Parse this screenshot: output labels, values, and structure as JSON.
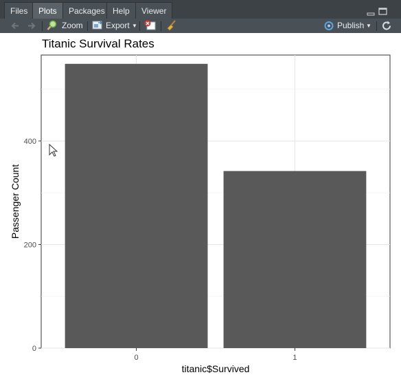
{
  "tabs": [
    {
      "label": "Files",
      "active": false
    },
    {
      "label": "Plots",
      "active": true
    },
    {
      "label": "Packages",
      "active": false
    },
    {
      "label": "Help",
      "active": false
    },
    {
      "label": "Viewer",
      "active": false
    }
  ],
  "toolbar": {
    "zoom_label": "Zoom",
    "export_label": "Export",
    "publish_label": "Publish"
  },
  "icons": {
    "back": "arrow-left-icon",
    "forward": "arrow-right-icon",
    "zoom": "magnifier-icon",
    "export": "export-icon",
    "remove": "remove-plot-icon",
    "clear": "broom-icon",
    "publish": "publish-icon",
    "refresh": "refresh-icon"
  },
  "colors": {
    "bar_fill": "#595959",
    "panel_background": "#ffffff",
    "grid": "#ebebeb",
    "tab_active": "#5b6368",
    "tabbar": "#3c4246"
  },
  "chart_data": {
    "type": "bar",
    "title": "Titanic Survival Rates",
    "xlabel": "titanic$Survived",
    "ylabel": "Passenger Count",
    "categories": [
      "0",
      "1"
    ],
    "values": [
      549,
      342
    ],
    "ylim": [
      0,
      566
    ],
    "yticks": [
      0,
      200,
      400
    ],
    "grid": true
  }
}
